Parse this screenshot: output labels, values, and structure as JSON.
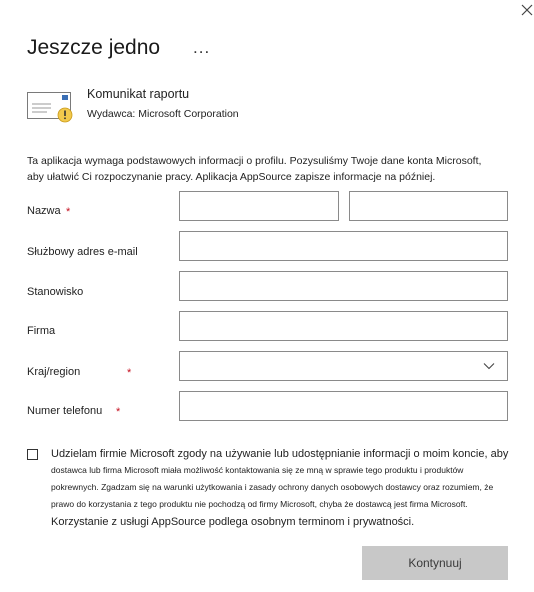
{
  "dialog": {
    "title": "Jeszcze jedno",
    "more_label": "...",
    "close_icon": "close-icon"
  },
  "app": {
    "icon": "report-message-icon",
    "name": "Komunikat raportu",
    "publisher": "Wydawca: Microsoft Corporation"
  },
  "intro_lines": [
    "Ta aplikacja wymaga podstawowych informacji o profilu. Pozysuliśmy Twoje dane konta Microsoft,",
    "aby ułatwić Ci rozpoczynanie pracy. Aplikacja AppSource zapisze informacje na później."
  ],
  "form": {
    "required_marker": "*",
    "name_label": "Nazwa",
    "first_name_value": "",
    "last_name_value": "",
    "email_label": "Służbowy adres e-mail",
    "email_value": "",
    "job_title_label": "Stanowisko",
    "job_title_value": "",
    "company_label": "Firma",
    "company_value": "",
    "country_label": "Kraj/region",
    "country_value": "",
    "phone_label": "Numer telefonu",
    "phone_value": ""
  },
  "consent": {
    "checked": false,
    "line1": "Udzielam firmie Microsoft zgody na używanie lub udostępnianie informacji o moim koncie, aby",
    "line2": "dostawca lub firma Microsoft miała możliwość kontaktowania się ze mną w sprawie tego produktu i produktów",
    "line3": "pokrewnych. Zgadzam się na warunki użytkowania i zasady ochrony danych osobowych dostawcy oraz rozumiem, że",
    "line4": "prawo do korzystania z tego produktu nie pochodzą od firmy Microsoft, chyba że dostawcą jest firma Microsoft.",
    "line5": "Korzystanie z usługi AppSource podlega osobnym terminom i prywatności."
  },
  "actions": {
    "continue_label": "Kontynuuj"
  },
  "colors": {
    "required": "#c50f1f",
    "button_bg": "#c8c8c8",
    "input_border": "#8a8a8a",
    "warning": "#f2c94c"
  }
}
